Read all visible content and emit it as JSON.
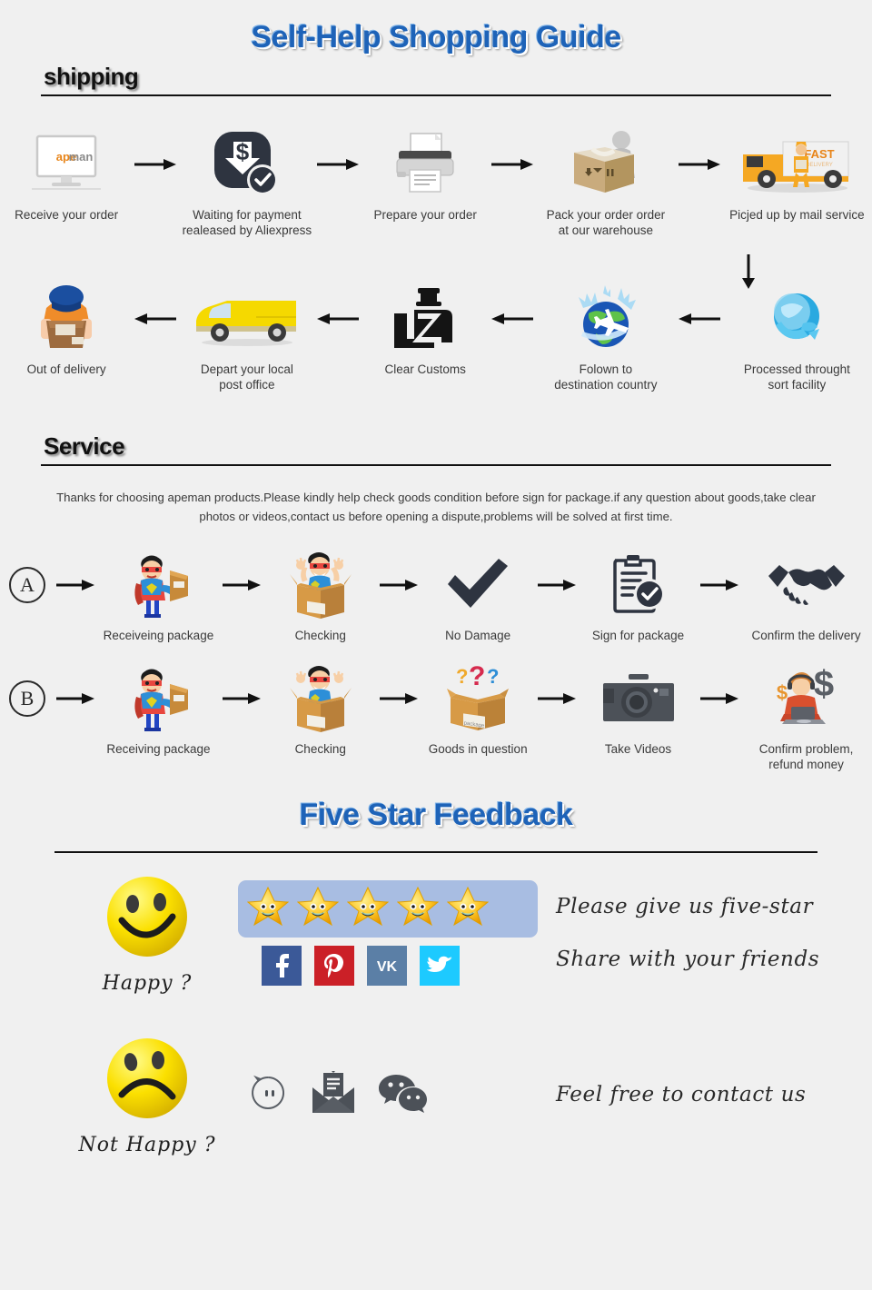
{
  "page": {
    "title": "Self-Help Shopping Guide",
    "background": "#f0f0f0",
    "title_color": "#1e63b8"
  },
  "shipping": {
    "heading": "shipping",
    "row1": [
      {
        "icon": "monitor-apeman-icon",
        "label": "Receive your order"
      },
      {
        "icon": "payment-dollar-check-icon",
        "label": "Waiting for payment\nrealeased by Aliexpress"
      },
      {
        "icon": "printer-icon",
        "label": "Prepare your order"
      },
      {
        "icon": "worker-packing-box-icon",
        "label": "Pack your order order\nat our warehouse"
      },
      {
        "icon": "fast-delivery-truck-icon",
        "label": "Picjed up by mail service"
      }
    ],
    "row2": [
      {
        "icon": "courier-delivery-person-icon",
        "label": "Out of delivery"
      },
      {
        "icon": "yellow-van-icon",
        "label": "Depart your local\npost office"
      },
      {
        "icon": "customs-officer-icon",
        "label": "Clear Customs"
      },
      {
        "icon": "globe-airplane-icon",
        "label": "Folown to\ndestination country"
      },
      {
        "icon": "sort-facility-globe-icon",
        "label": "Processed throught\nsort facility"
      }
    ]
  },
  "service": {
    "heading": "Service",
    "paragraph": "Thanks for choosing apeman products.Please kindly help check goods condition before sign for package.if any question about goods,take clear photos or videos,contact us before opening a dispute,problems will be solved at first time.",
    "rowA": {
      "badge": "A",
      "steps": [
        {
          "icon": "superhero-holding-package-icon",
          "label": "Receiveing package"
        },
        {
          "icon": "person-in-open-box-icon",
          "label": "Checking"
        },
        {
          "icon": "check-mark-icon",
          "label": "No Damage"
        },
        {
          "icon": "clipboard-check-icon",
          "label": "Sign for package"
        },
        {
          "icon": "handshake-icon",
          "label": "Confirm the delivery"
        }
      ]
    },
    "rowB": {
      "badge": "B",
      "steps": [
        {
          "icon": "superhero-holding-package-icon",
          "label": "Receiving package"
        },
        {
          "icon": "person-in-open-box-icon",
          "label": "Checking"
        },
        {
          "icon": "box-with-question-marks-icon",
          "label": "Goods in question"
        },
        {
          "icon": "camera-icon",
          "label": "Take Videos"
        },
        {
          "icon": "support-agent-dollar-icon",
          "label": "Confirm problem,\nrefund money"
        }
      ]
    }
  },
  "feedback": {
    "heading": "Five Star Feedback",
    "happy": {
      "icon": "happy-face-icon",
      "label": "Happy ?",
      "stars": 5,
      "star_bar_color": "#a8bde2",
      "text_line1": "Please give us five-star",
      "text_line2": "Share with your friends",
      "socials": [
        {
          "name": "facebook",
          "glyph": "f",
          "color": "#3b5998"
        },
        {
          "name": "pinterest",
          "glyph": "P",
          "color": "#cb2027"
        },
        {
          "name": "vk",
          "glyph": "VK",
          "color": "#5b7fa6"
        },
        {
          "name": "twitter",
          "glyph": "t",
          "color": "#1dcaff"
        }
      ]
    },
    "not_happy": {
      "icon": "sad-face-icon",
      "label": "Not Happy ?",
      "text_line1": "Feel free to contact us",
      "contacts": [
        {
          "name": "aliexpress-smiley-icon"
        },
        {
          "name": "open-envelope-message-icon"
        },
        {
          "name": "wechat-icon"
        }
      ]
    }
  }
}
